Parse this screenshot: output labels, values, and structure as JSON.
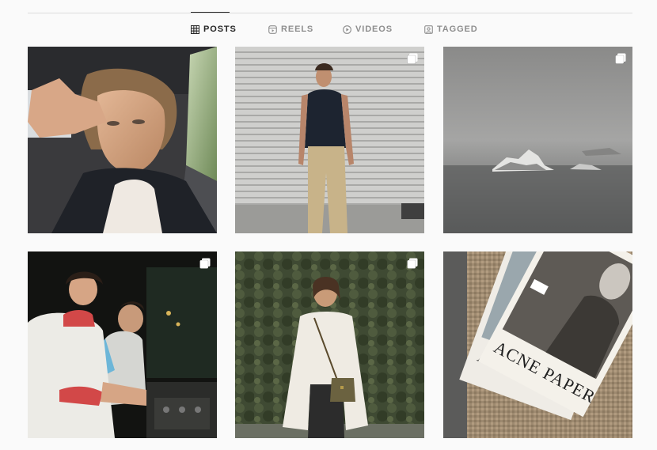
{
  "tabs": [
    {
      "label": "POSTS",
      "icon": "grid-icon",
      "active": true
    },
    {
      "label": "REELS",
      "icon": "reels-icon",
      "active": false
    },
    {
      "label": "VIDEOS",
      "icon": "play-circle-icon",
      "active": false
    },
    {
      "label": "TAGGED",
      "icon": "tagged-user-icon",
      "active": false
    }
  ],
  "posts": [
    {
      "subject": "selfie in car",
      "multi": false
    },
    {
      "subject": "man in black vest against shutter",
      "multi": true
    },
    {
      "subject": "foggy sea with rocky islands",
      "multi": true
    },
    {
      "subject": "two DJs at mixer",
      "multi": true
    },
    {
      "subject": "man in white jacket with crossbody bag",
      "multi": true
    },
    {
      "subject": "magazines",
      "multi": false
    }
  ],
  "magazine": {
    "cover_title": "ACNE PAPER",
    "back_title": "ACNE"
  },
  "colors": {
    "tab_active": "#262626",
    "tab_inactive": "#8e8e8e",
    "divider": "#dbdbdb",
    "background": "#fafafa"
  }
}
